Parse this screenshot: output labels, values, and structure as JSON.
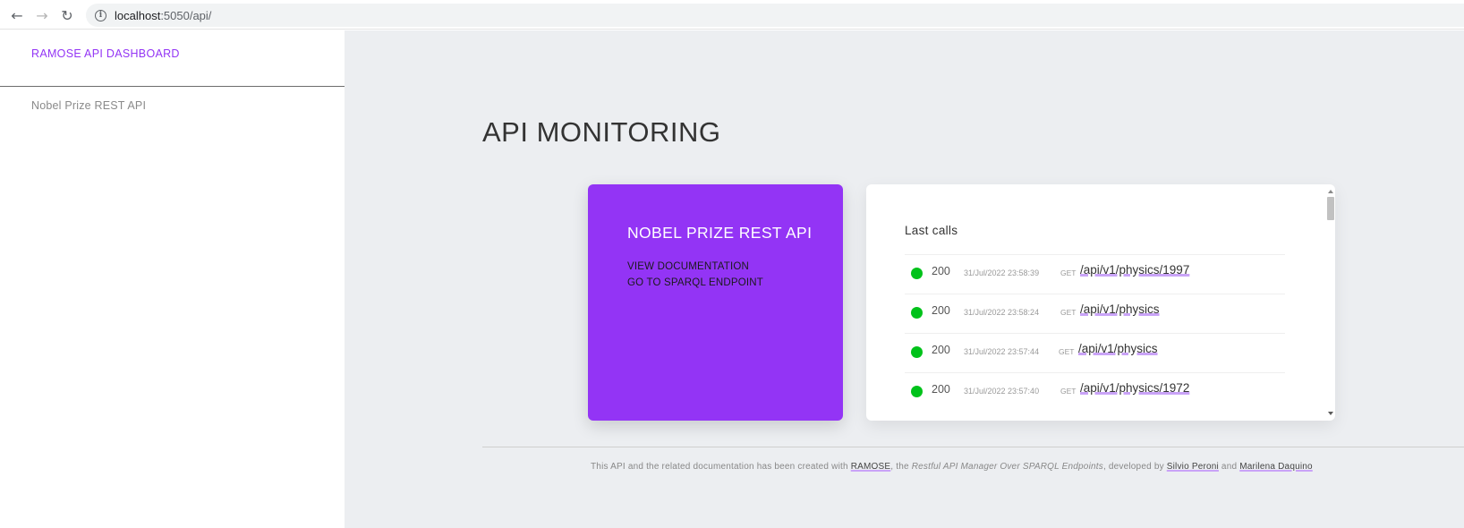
{
  "browser": {
    "url_host": "localhost",
    "url_path": ":5050/api/"
  },
  "sidebar": {
    "brand": "RAMOSE API DASHBOARD",
    "items": [
      {
        "label": "Nobel Prize REST API"
      }
    ]
  },
  "main": {
    "title": "API MONITORING",
    "api_card": {
      "title": "NOBEL PRIZE REST API",
      "links": [
        "VIEW DOCUMENTATION",
        "GO TO SPARQL ENDPOINT"
      ],
      "color": "#9334f5"
    },
    "calls": {
      "title": "Last calls",
      "status_color": "#00c21a",
      "rows": [
        {
          "status": "200",
          "time": "31/Jul/2022 23:58:39",
          "method": "GET",
          "path": "/api/v1/physics/1997"
        },
        {
          "status": "200",
          "time": "31/Jul/2022 23:58:24",
          "method": "GET",
          "path": "/api/v1/physics"
        },
        {
          "status": "200",
          "time": "31/Jul/2022 23:57:44",
          "method": "GET",
          "path": "/api/v1/physics"
        },
        {
          "status": "200",
          "time": "31/Jul/2022 23:57:40",
          "method": "GET",
          "path": "/api/v1/physics/1972"
        }
      ]
    },
    "footer": {
      "t1": "This API and the related documentation has been created with ",
      "l1": "RAMOSE",
      "t2": ", the ",
      "em": "Restful API Manager Over SPARQL Endpoints",
      "t3": ", developed by ",
      "l2": "Silvio Peroni",
      "t4": " and ",
      "l3": "Marilena Daquino"
    }
  }
}
